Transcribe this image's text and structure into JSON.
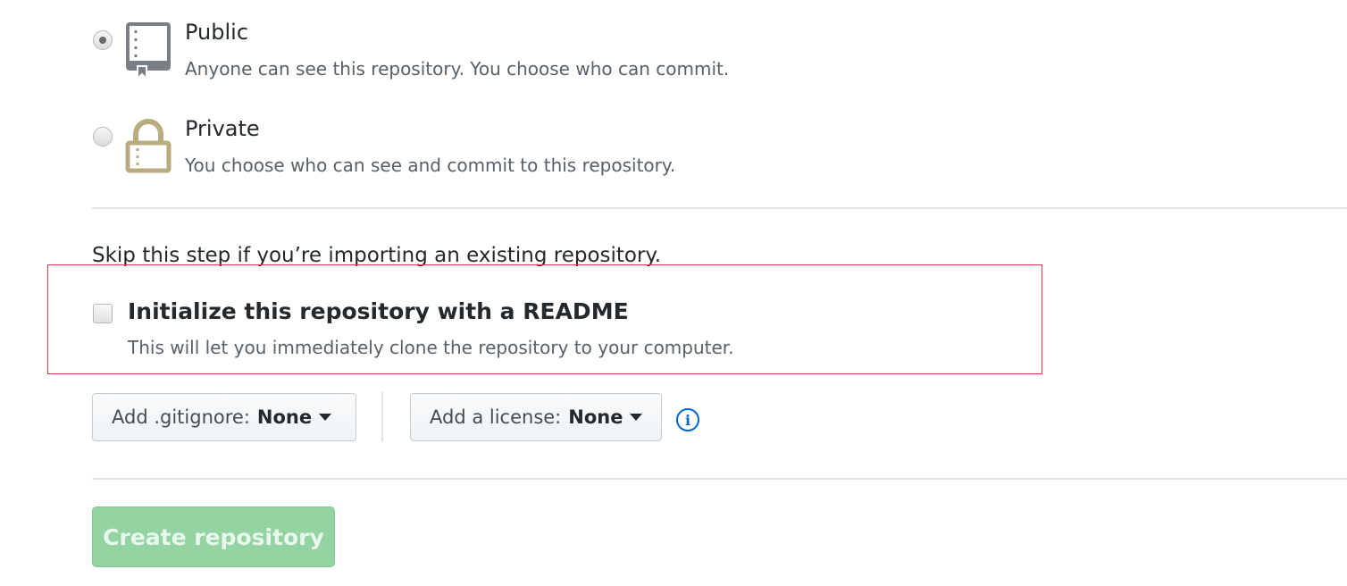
{
  "visibility": {
    "public": {
      "title": "Public",
      "description": "Anyone can see this repository. You choose who can commit.",
      "selected": true,
      "icon": "repo-book-icon"
    },
    "private": {
      "title": "Private",
      "description": "You choose who can see and commit to this repository.",
      "selected": false,
      "icon": "lock-icon"
    }
  },
  "init": {
    "skip_text": "Skip this step if you’re importing an existing repository.",
    "readme_label": "Initialize this repository with a README",
    "readme_description": "This will let you immediately clone the repository to your computer.",
    "readme_checked": false
  },
  "selectors": {
    "gitignore_label": "Add .gitignore:",
    "gitignore_value": "None",
    "license_label": "Add a license:",
    "license_value": "None"
  },
  "actions": {
    "create_label": "Create repository"
  },
  "colors": {
    "accent_blue": "#0366d6",
    "create_button": "#94d3a2",
    "highlight_border": "#d73a49",
    "icon_tan": "#b9ac7f",
    "icon_gray": "#7a7f85"
  }
}
